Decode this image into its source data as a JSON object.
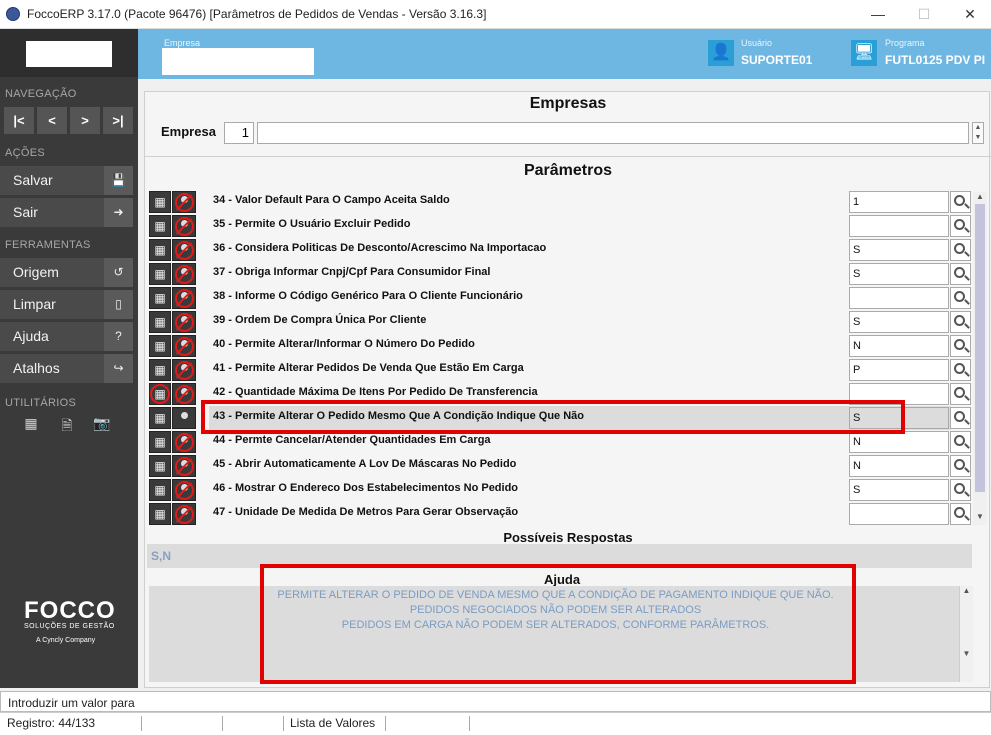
{
  "window": {
    "title": "FoccoERP 3.17.0 (Pacote 96476) [Parâmetros de Pedidos de Vendas - Versão 3.16.3]",
    "minimize": "—",
    "maximize": "☐",
    "close": "✕"
  },
  "sidebar": {
    "navegacao_label": "NAVEGAÇÃO",
    "nav_buttons": [
      "|<",
      "<",
      ">",
      ">|"
    ],
    "acoes_label": "AÇÕES",
    "salvar": "Salvar",
    "sair": "Sair",
    "ferramentas_label": "FERRAMENTAS",
    "origem": "Origem",
    "limpar": "Limpar",
    "ajuda": "Ajuda",
    "atalhos": "Atalhos",
    "utilitarios_label": "UTILITÁRIOS",
    "logo": {
      "name": "FOCCO",
      "tagline": "SOLUÇÕES DE GESTÃO",
      "company": "A Cyncly Company"
    }
  },
  "header": {
    "empresa_label": "Empresa",
    "usuario_label": "Usuário",
    "usuario_value": "SUPORTE01",
    "programa_label": "Programa",
    "programa_value": "FUTL0125 PDV PI",
    "accent_color": "#6fb7e3"
  },
  "empresas": {
    "title": "Empresas",
    "field_label": "Empresa",
    "code": "1"
  },
  "parametros": {
    "title": "Parâmetros",
    "rows": [
      {
        "label": "34 - Valor Default Para O Campo Aceita Saldo",
        "value": "1"
      },
      {
        "label": "35 - Permite O Usuário Excluir Pedido",
        "value": ""
      },
      {
        "label": "36 - Considera Politicas De Desconto/Acrescimo Na Importacao",
        "value": "S"
      },
      {
        "label": "37 - Obriga Informar Cnpj/Cpf Para Consumidor Final",
        "value": "S"
      },
      {
        "label": "38 - Informe O Código Genérico Para O Cliente Funcionário",
        "value": ""
      },
      {
        "label": "39 - Ordem De Compra Única Por Cliente",
        "value": "S"
      },
      {
        "label": "40 - Permite Alterar/Informar O Número Do Pedido",
        "value": "N"
      },
      {
        "label": "41 - Permite Alterar Pedidos De Venda Que Estão Em Carga",
        "value": "P"
      },
      {
        "label": "42 - Quantidade Máxima De Itens Por Pedido De Transferencia",
        "value": ""
      },
      {
        "label": "43 - Permite Alterar O Pedido Mesmo Que A Condição Indique Que Não",
        "value": "S"
      },
      {
        "label": "44 - Permte Cancelar/Atender Quantidades Em Carga",
        "value": "N"
      },
      {
        "label": "45 - Abrir Automaticamente A Lov De Máscaras No Pedido",
        "value": "N"
      },
      {
        "label": "46 - Mostrar O Endereco Dos Estabelecimentos No Pedido",
        "value": "S"
      },
      {
        "label": "47 - Unidade De Medida De Metros Para Gerar Observação",
        "value": ""
      }
    ]
  },
  "possiveis": {
    "title": "Possíveis Respostas",
    "value": "S,N"
  },
  "ajuda": {
    "title": "Ajuda",
    "line1": "PERMITE ALTERAR O PEDIDO DE VENDA MESMO QUE A CONDIÇÃO DE PAGAMENTO INDIQUE QUE NÃO.",
    "line2": "PEDIDOS NEGOCIADOS NÃO PODEM SER ALTERADOS",
    "line3": "PEDIDOS EM CARGA NÃO PODEM SER ALTERADOS, CONFORME PARÂMETROS."
  },
  "status": {
    "message": "Introduzir um valor para",
    "registro": "Registro: 44/133",
    "lista": "Lista de Valores"
  }
}
